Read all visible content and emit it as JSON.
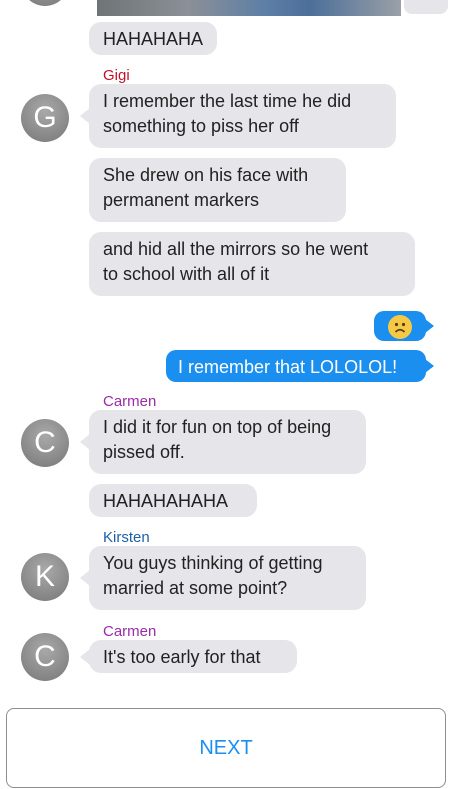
{
  "chat": {
    "top_avatar_letter": "",
    "messages": [
      {
        "type": "received",
        "text": "HAHAHAHA"
      },
      {
        "type": "received",
        "sender": "Gigi",
        "sender_color": "#c0102a",
        "avatar": "G",
        "text": "I remember the last time he did\nsomething to piss her off"
      },
      {
        "type": "received",
        "text": "She drew on his face with\npermanent markers"
      },
      {
        "type": "received",
        "text": "and hid all the mirrors so he went\nto school with all of it"
      },
      {
        "type": "sent_emoji",
        "emoji": "frowning-face"
      },
      {
        "type": "sent",
        "text": "I remember that LOLOLOL!"
      },
      {
        "type": "received",
        "sender": "Carmen",
        "sender_color": "#9b2ba8",
        "avatar": "C",
        "text": "I did it for fun on top of being\npissed off."
      },
      {
        "type": "received",
        "text": "HAHAHAHAHA"
      },
      {
        "type": "received",
        "sender": "Kirsten",
        "sender_color": "#1f5fa8",
        "avatar": "K",
        "text": "You guys thinking of getting\nmarried at some point?"
      },
      {
        "type": "received",
        "sender": "Carmen",
        "sender_color": "#9b2ba8",
        "avatar": "C",
        "text": "It's too early for that"
      }
    ]
  },
  "footer": {
    "next_label": "NEXT"
  },
  "colors": {
    "accent": "#1a8ff0",
    "bubble_gray": "#e5e5ea"
  }
}
